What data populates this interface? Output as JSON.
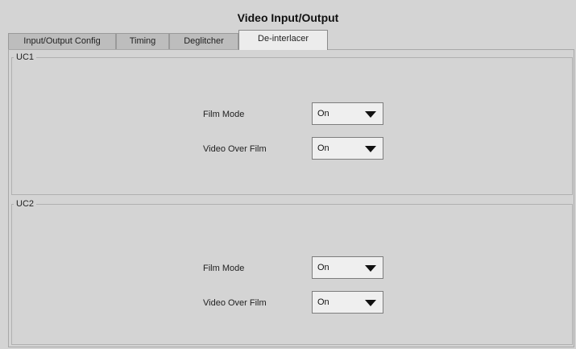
{
  "window": {
    "title": "Video Input/Output"
  },
  "tabs": [
    {
      "label": "Input/Output Config"
    },
    {
      "label": "Timing"
    },
    {
      "label": "Deglitcher"
    },
    {
      "label": "De-interlacer",
      "active": true
    }
  ],
  "groups": [
    {
      "legend": "UC1",
      "rows": [
        {
          "label": "Film Mode",
          "value": "On"
        },
        {
          "label": "Video Over Film",
          "value": "On"
        }
      ]
    },
    {
      "legend": "UC2",
      "rows": [
        {
          "label": "Film Mode",
          "value": "On"
        },
        {
          "label": "Video Over Film",
          "value": "On"
        }
      ]
    }
  ],
  "icons": {
    "dropdown": "triangle-down-icon"
  }
}
